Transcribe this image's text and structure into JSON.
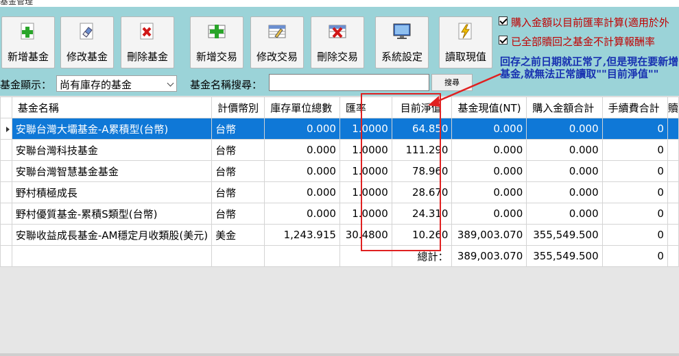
{
  "window": {
    "title": "基金管理"
  },
  "toolbar": [
    {
      "label": "新增基金",
      "icon": "plus-icon"
    },
    {
      "label": "修改基金",
      "icon": "eraser-icon"
    },
    {
      "label": "刪除基金",
      "icon": "x-icon"
    },
    {
      "label": "新增交易",
      "icon": "table-plus-icon"
    },
    {
      "label": "修改交易",
      "icon": "table-edit-icon"
    },
    {
      "label": "刪除交易",
      "icon": "table-delete-icon"
    },
    {
      "label": "系統設定",
      "icon": "monitor-icon"
    },
    {
      "label": "讀取現值",
      "icon": "lightning-icon"
    }
  ],
  "options": {
    "opt1": "購入金額以目前匯率計算(適用於外",
    "opt2": "已全部贖回之基金不計算報酬率"
  },
  "filter": {
    "label": "基金顯示：",
    "value": "尚有庫存的基金"
  },
  "search": {
    "label": "基金名稱搜尋：",
    "value": "",
    "button": "搜尋"
  },
  "annotation": "回存之前日期就正常了,但是現在要新增基金,就無法正常讀取\"\"目前淨值\"\"",
  "table": {
    "headers": [
      "基金名稱",
      "計價幣別",
      "庫存單位總數",
      "匯率",
      "目前淨值",
      "基金現值(NT)",
      "購入金額合計",
      "手續費合計",
      "贖"
    ],
    "rows": [
      [
        "安聯台灣大壩基金-A累積型(台幣)",
        "台幣",
        "0.000",
        "1.0000",
        "64.850",
        "0.000",
        "0.000",
        "0",
        ""
      ],
      [
        "安聯台灣科技基金",
        "台幣",
        "0.000",
        "1.0000",
        "111.290",
        "0.000",
        "0.000",
        "0",
        ""
      ],
      [
        "安聯台灣智慧基金基金",
        "台幣",
        "0.000",
        "1.0000",
        "78.960",
        "0.000",
        "0.000",
        "0",
        ""
      ],
      [
        "野村積極成長",
        "台幣",
        "0.000",
        "1.0000",
        "28.670",
        "0.000",
        "0.000",
        "0",
        ""
      ],
      [
        "野村優質基金-累積S類型(台幣)",
        "台幣",
        "0.000",
        "1.0000",
        "24.310",
        "0.000",
        "0.000",
        "0",
        ""
      ],
      [
        "安聯收益成長基金-AM穩定月收類股(美元)",
        "美金",
        "1,243.915",
        "30.4800",
        "10.260",
        "389,003.070",
        "355,549.500",
        "0",
        ""
      ]
    ],
    "total": {
      "label": "總計：",
      "current_value": "389,003.070",
      "purchase_total": "355,549.500",
      "fee_total": "0"
    }
  }
}
